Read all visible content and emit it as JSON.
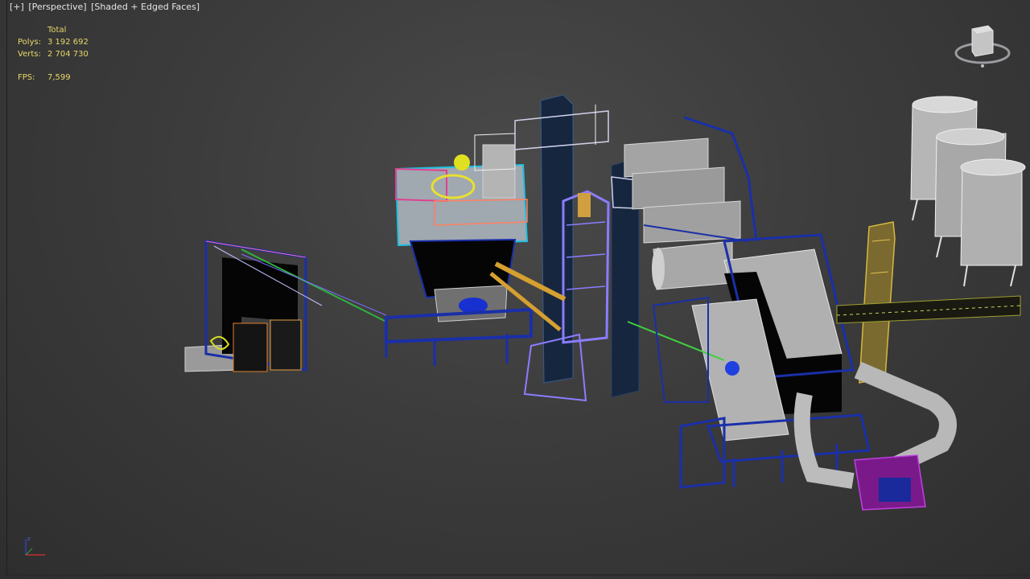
{
  "viewport": {
    "labels": [
      "[+]",
      "[Perspective]",
      "[Shaded + Edged Faces]"
    ]
  },
  "stats": {
    "header": "Total",
    "polys_label": "Polys:",
    "polys_value": "3 192 692",
    "verts_label": "Verts:",
    "verts_value": "2 704 730",
    "fps_label": "FPS:",
    "fps_value": "7,599"
  },
  "icons": {
    "viewcube": "viewcube-icon",
    "axis": "axis-tripod-icon"
  },
  "colors": {
    "background": "#3c3c3c",
    "stats_text": "#e8d86a",
    "steel_blue": "#1a2fa8",
    "navy": "#16263f",
    "wire_violet": "#8a7dff",
    "silver": "#a8a8a8",
    "ochre": "#c9a640",
    "magenta": "#b030c8"
  }
}
